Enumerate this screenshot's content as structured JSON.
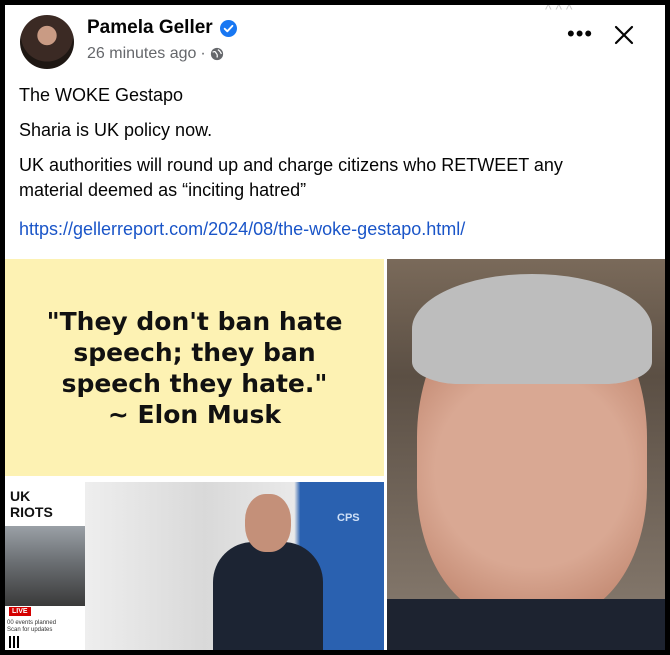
{
  "post": {
    "author": "Pamela Geller",
    "time": "26 minutes ago",
    "time_sep": "·",
    "more_label": "•••",
    "faint_reactions": "^ ^ ^",
    "lines": [
      "The WOKE Gestapo",
      "Sharia is UK policy now.",
      "UK authorities will round up and charge citizens who RETWEET any\nmaterial deemed as “inciting hatred”"
    ],
    "link": "https://gellerreport.com/2024/08/the-woke-gestapo.html/"
  },
  "media": {
    "quote": "\"They don't ban hate\nspeech; they ban\nspeech they hate.\"\n~ Elon Musk",
    "riots_title": "UK\nRIOTS",
    "live_label": "LIVE",
    "riots_caption": "00 events planned\nScan for updates",
    "cps_label": "CPS"
  },
  "colors": {
    "verified": "#1877f2",
    "link": "#1a55c8",
    "quote_bg": "#fdf2b3"
  }
}
